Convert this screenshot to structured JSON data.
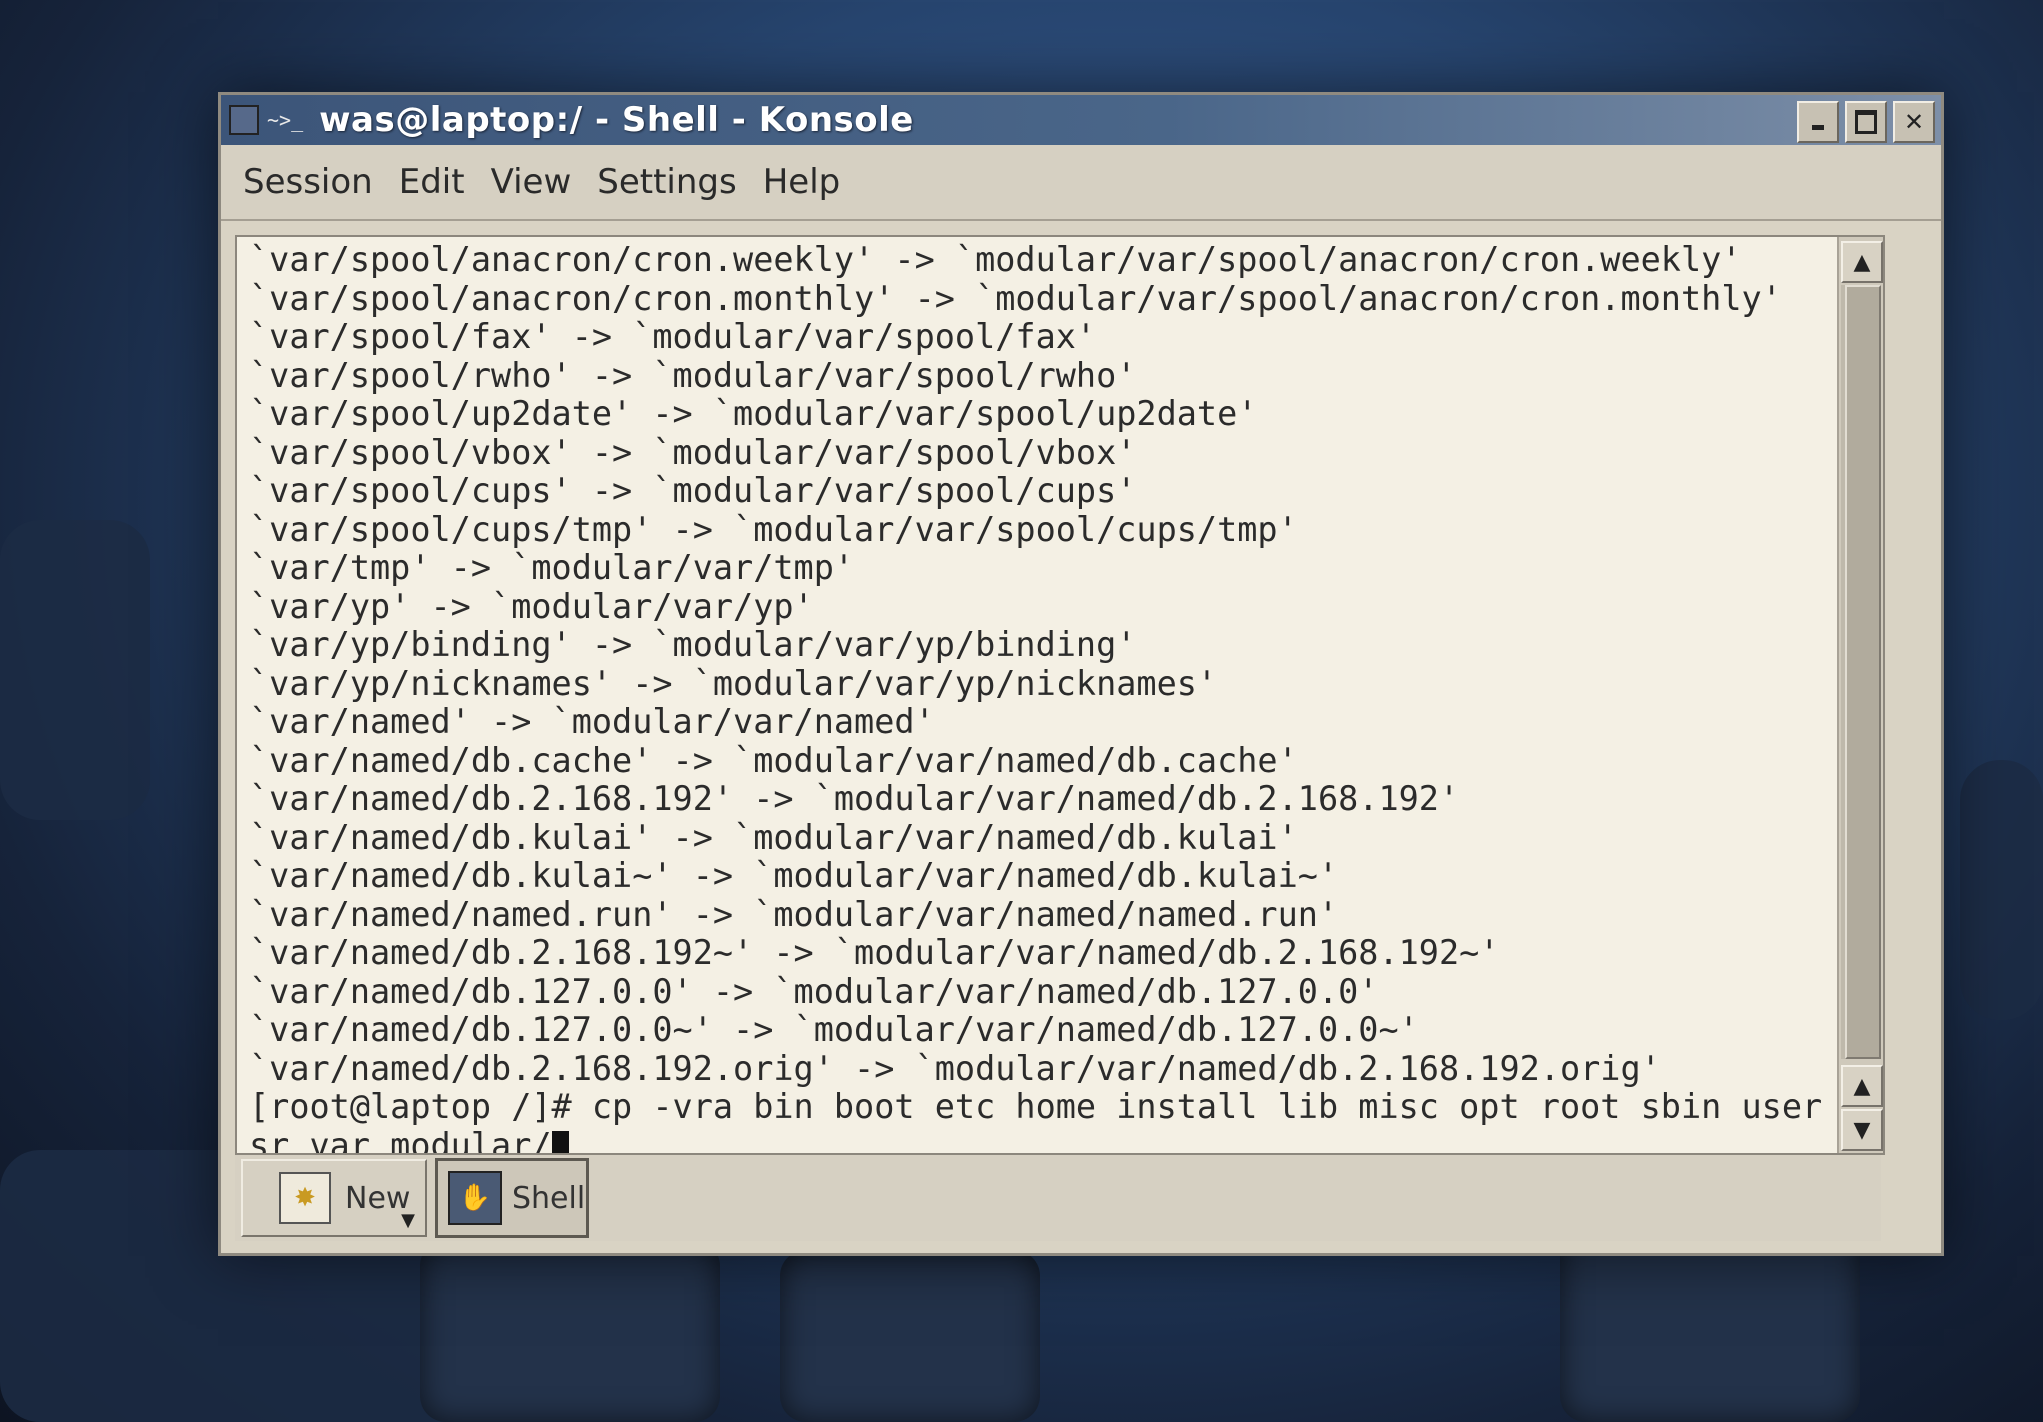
{
  "window": {
    "title": "was@laptop:/ - Shell - Konsole",
    "app_icon": "~>_",
    "buttons": [
      "minimize",
      "maximize",
      "close"
    ]
  },
  "menubar": [
    "Session",
    "Edit",
    "View",
    "Settings",
    "Help"
  ],
  "terminal": {
    "lines": [
      "`var/spool/anacron/cron.weekly' -> `modular/var/spool/anacron/cron.weekly'",
      "`var/spool/anacron/cron.monthly' -> `modular/var/spool/anacron/cron.monthly'",
      "`var/spool/fax' -> `modular/var/spool/fax'",
      "`var/spool/rwho' -> `modular/var/spool/rwho'",
      "`var/spool/up2date' -> `modular/var/spool/up2date'",
      "`var/spool/vbox' -> `modular/var/spool/vbox'",
      "`var/spool/cups' -> `modular/var/spool/cups'",
      "`var/spool/cups/tmp' -> `modular/var/spool/cups/tmp'",
      "`var/tmp' -> `modular/var/tmp'",
      "`var/yp' -> `modular/var/yp'",
      "`var/yp/binding' -> `modular/var/yp/binding'",
      "`var/yp/nicknames' -> `modular/var/yp/nicknames'",
      "`var/named' -> `modular/var/named'",
      "`var/named/db.cache' -> `modular/var/named/db.cache'",
      "`var/named/db.2.168.192' -> `modular/var/named/db.2.168.192'",
      "`var/named/db.kulai' -> `modular/var/named/db.kulai'",
      "`var/named/db.kulai~' -> `modular/var/named/db.kulai~'",
      "`var/named/named.run' -> `modular/var/named/named.run'",
      "`var/named/db.2.168.192~' -> `modular/var/named/db.2.168.192~'",
      "`var/named/db.127.0.0' -> `modular/var/named/db.127.0.0'",
      "`var/named/db.127.0.0~' -> `modular/var/named/db.127.0.0~'",
      "`var/named/db.2.168.192.orig' -> `modular/var/named/db.2.168.192.orig'"
    ],
    "prompt_line_1": "[root@laptop /]# cp -vra bin boot etc home install lib misc opt root sbin user u",
    "prompt_line_2": "sr var modular/"
  },
  "tabs": {
    "new_label": "New",
    "shell_label": "Shell"
  }
}
